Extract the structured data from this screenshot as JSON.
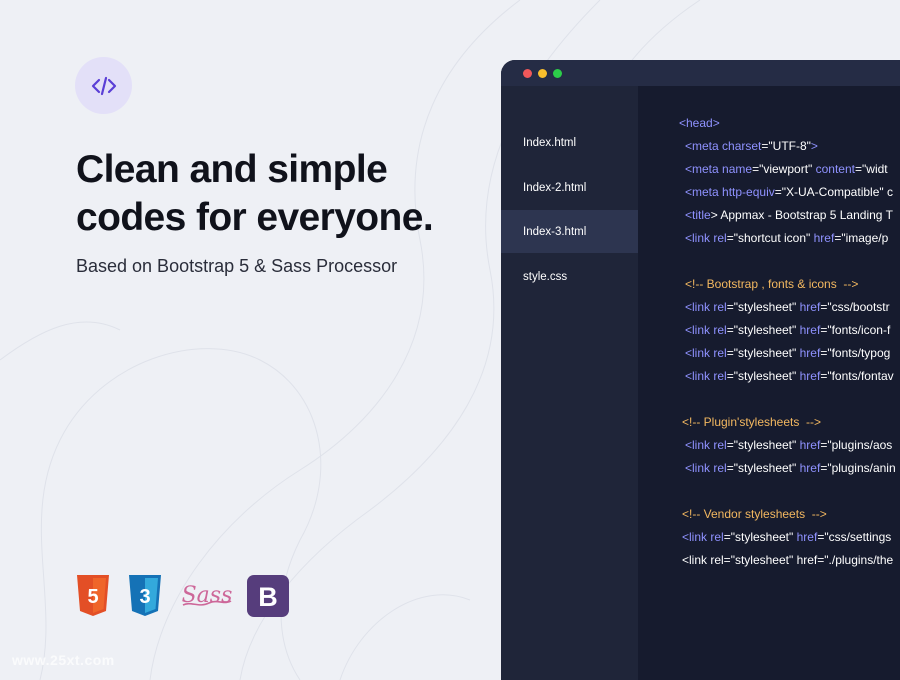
{
  "hero": {
    "headline": "Clean and simple codes for everyone.",
    "subheadline": "Based on Bootstrap 5 & Sass Processor"
  },
  "logos": [
    {
      "name": "html5",
      "label": "5"
    },
    {
      "name": "css3",
      "label": "3"
    },
    {
      "name": "sass",
      "label": "Sass"
    },
    {
      "name": "bootstrap",
      "label": "B"
    }
  ],
  "watermark": "www.25xt.com",
  "editor": {
    "window_controls": [
      "close",
      "minimize",
      "maximize"
    ],
    "files": [
      {
        "label": "Index.html",
        "active": false
      },
      {
        "label": "Index-2.html",
        "active": false
      },
      {
        "label": "Index-3.html",
        "active": true
      },
      {
        "label": "style.css",
        "active": false
      }
    ],
    "code_lines": [
      "<head>",
      "<meta charset=\"UTF-8\">",
      "<meta name=\"viewport\" content=\"widt",
      "<meta http-equiv=\"X-UA-Compatible\" c",
      "<title> Appmax - Bootstrap 5 Landing T",
      "<link rel=\"shortcut icon\" href=\"image/p",
      "<!-- Bootstrap , fonts & icons  -->",
      "<link rel=\"stylesheet\" href=\"css/bootstr",
      "<link rel=\"stylesheet\" href=\"fonts/icon-f",
      "<link rel=\"stylesheet\" href=\"fonts/typog",
      "<link rel=\"stylesheet\" href=\"fonts/fontav",
      "<!-- Plugin'stylesheets  -->",
      "<link rel=\"stylesheet\" href=\"plugins/aos",
      "<link rel=\"stylesheet\" href=\"plugins/anin",
      "<!-- Vendor stylesheets  -->",
      "<link rel=\"stylesheet\" href=\"css/settings",
      "<link rel=\"stylesheet\" href=\"./plugins/the"
    ]
  },
  "colors": {
    "background": "#eef0f5",
    "editor_bg": "#161b2e",
    "sidebar_bg": "#1f2539",
    "active_file_bg": "#2d3550",
    "code_tag": "#8f92ff",
    "code_comment": "#f3b860",
    "accent": "#5b3fd6"
  }
}
